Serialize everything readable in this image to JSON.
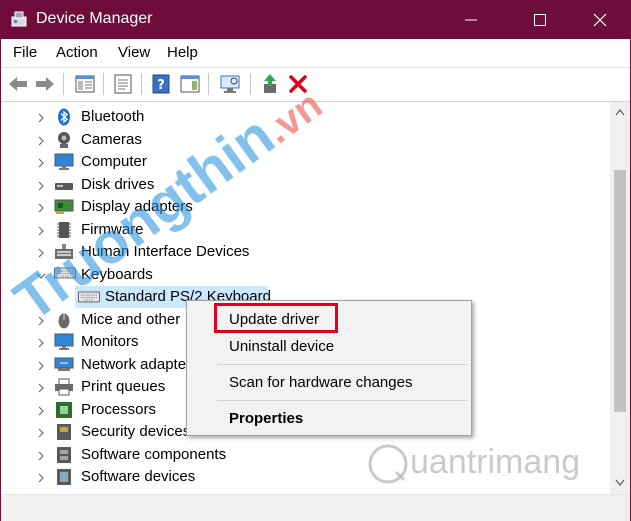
{
  "colors": {
    "titlebar": "#6e0d3c",
    "selection": "#cce8ff",
    "highlight_box": "#e0001b",
    "delete_icon": "#e0001b",
    "watermark_blue": "#1e8cdc",
    "watermark_red": "#e63228"
  },
  "window": {
    "title": "Device Manager",
    "icon": "device-manager-icon",
    "controls": [
      "minimize-icon",
      "maximize-icon",
      "close-icon"
    ]
  },
  "menu": {
    "file": "File",
    "action": "Action",
    "view": "View",
    "help": "Help"
  },
  "toolbar": {
    "buttons": [
      "back-arrow-icon",
      "forward-arrow-icon",
      "show-hide-console-tree-icon",
      "properties-icon",
      "help-icon",
      "action-pane-icon",
      "scan-hardware-icon",
      "update-driver-icon",
      "uninstall-device-icon"
    ]
  },
  "tree": {
    "categories": [
      {
        "label": "Bluetooth",
        "icon": "bluetooth-icon",
        "expanded": false
      },
      {
        "label": "Cameras",
        "icon": "camera-icon",
        "expanded": false
      },
      {
        "label": "Computer",
        "icon": "monitor-icon",
        "expanded": false
      },
      {
        "label": "Disk drives",
        "icon": "disk-drive-icon",
        "expanded": false
      },
      {
        "label": "Display adapters",
        "icon": "display-adapter-icon",
        "expanded": false
      },
      {
        "label": "Firmware",
        "icon": "firmware-chip-icon",
        "expanded": false
      },
      {
        "label": "Human Interface Devices",
        "icon": "hid-icon",
        "expanded": false
      },
      {
        "label": "Keyboards",
        "icon": "keyboard-icon",
        "expanded": true
      },
      {
        "label": "Mice and other",
        "icon": "mouse-icon",
        "expanded": false
      },
      {
        "label": "Monitors",
        "icon": "monitor-icon",
        "expanded": false
      },
      {
        "label": "Network adapte",
        "icon": "network-adapter-icon",
        "expanded": false
      },
      {
        "label": "Print queues",
        "icon": "printer-icon",
        "expanded": false
      },
      {
        "label": "Processors",
        "icon": "processor-icon",
        "expanded": false
      },
      {
        "label": "Security devices",
        "icon": "security-device-icon",
        "expanded": false
      },
      {
        "label": "Software components",
        "icon": "software-component-icon",
        "expanded": false
      },
      {
        "label": "Software devices",
        "icon": "software-device-icon",
        "expanded": false
      }
    ],
    "selected_child": {
      "label": "Standard PS/2 Keyboard",
      "icon": "keyboard-icon",
      "parent": "Keyboards"
    }
  },
  "context_menu": {
    "update_driver": "Update driver",
    "uninstall_device": "Uninstall device",
    "scan": "Scan for hardware changes",
    "properties": "Properties"
  },
  "watermarks": {
    "left_text": "Truongthin",
    "left_suffix": ".vn",
    "right_text": "uantrimang"
  }
}
